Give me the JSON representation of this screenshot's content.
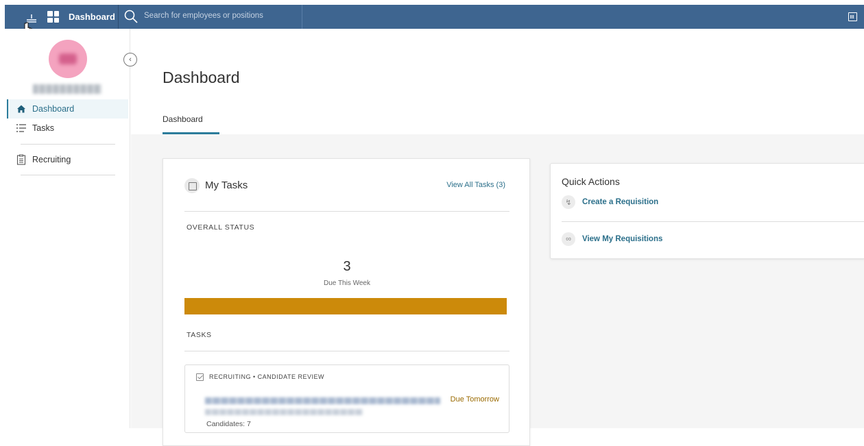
{
  "topbar": {
    "home_label": "Dashboard",
    "search_placeholder": "Search for employees or positions"
  },
  "sidebar": {
    "items": [
      {
        "label": "Dashboard",
        "icon": "home-icon",
        "active": true
      },
      {
        "label": "Tasks",
        "icon": "list-icon",
        "active": false
      },
      {
        "label": "Recruiting",
        "icon": "clipboard-icon",
        "active": false
      }
    ]
  },
  "main": {
    "page_title": "Dashboard",
    "tabs": [
      {
        "label": "Dashboard",
        "active": true
      }
    ],
    "my_tasks": {
      "title": "My Tasks",
      "view_all": "View All Tasks (3)",
      "overall_status_label": "OVERALL STATUS",
      "count": "3",
      "count_caption": "Due This Week",
      "status_color": "#cc8a0a",
      "tasks_label": "TASKS",
      "task": {
        "category": "RECRUITING • CANDIDATE REVIEW",
        "due": "Due Tomorrow",
        "candidates": "Candidates: 7"
      }
    },
    "quick_actions": {
      "title": "Quick Actions",
      "items": [
        {
          "label": "Create a Requisition",
          "icon": "lightning-icon"
        },
        {
          "label": "View My Requisitions",
          "icon": "link-icon"
        }
      ]
    }
  },
  "colors": {
    "topbar": "#3e6590",
    "accent": "#2b7c9b",
    "link": "#2b6f8a",
    "due": "#9a6a00"
  }
}
